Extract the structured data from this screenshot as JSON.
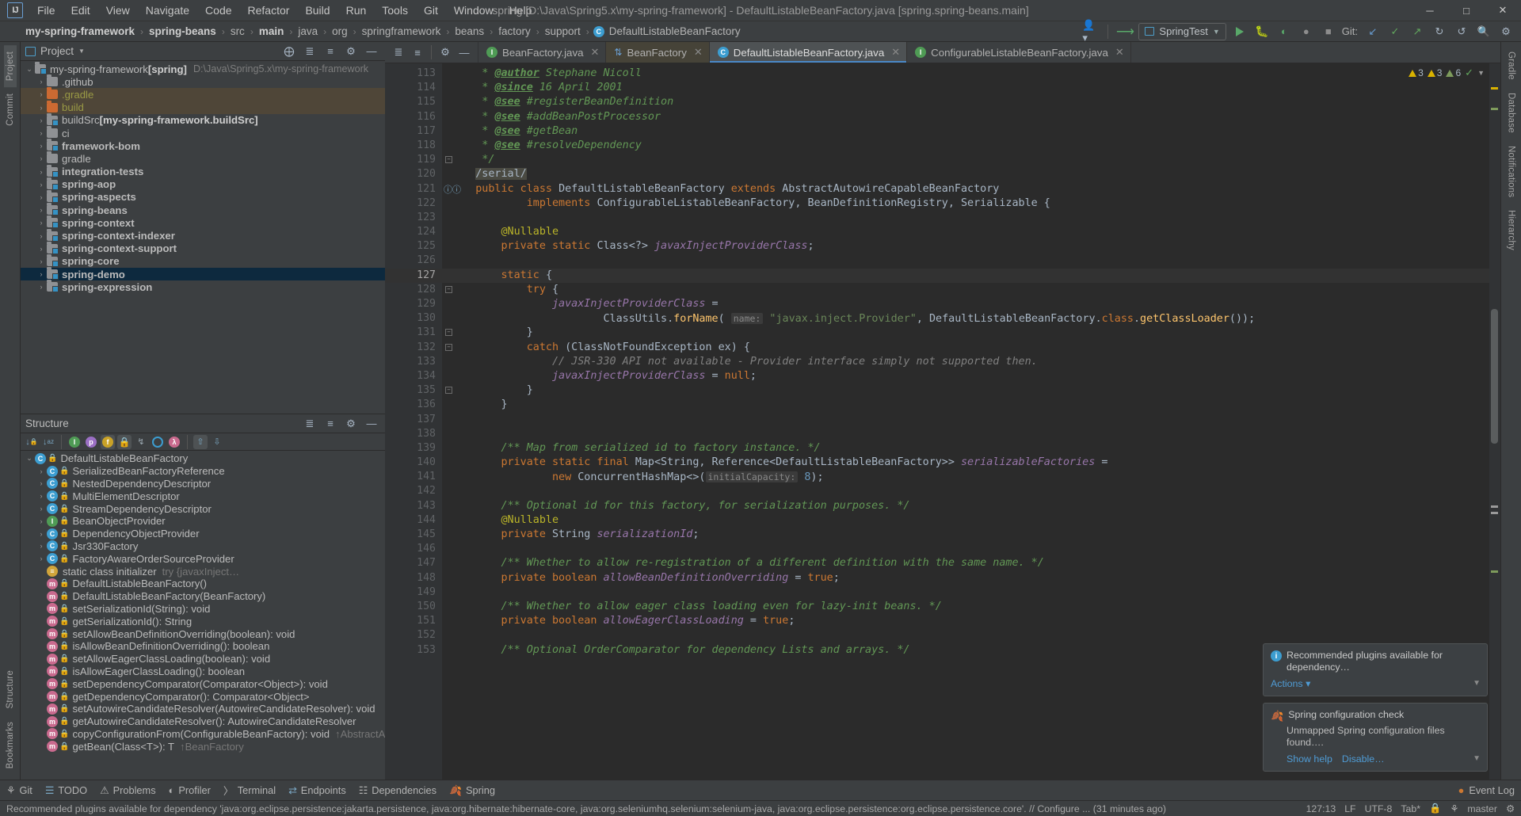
{
  "titlebar": {
    "logo": "IJ",
    "menus": [
      "File",
      "Edit",
      "View",
      "Navigate",
      "Code",
      "Refactor",
      "Build",
      "Run",
      "Tools",
      "Git",
      "Window",
      "Help"
    ],
    "window_title": "spring [D:\\Java\\Spring5.x\\my-spring-framework] - DefaultListableBeanFactory.java [spring.spring-beans.main]",
    "minimize": "─",
    "maximize": "□",
    "close": "✕"
  },
  "navbar": {
    "crumbs": [
      {
        "text": "my-spring-framework",
        "bold": true
      },
      {
        "text": "spring-beans",
        "bold": true
      },
      {
        "text": "src",
        "bold": false
      },
      {
        "text": "main",
        "bold": true
      },
      {
        "text": "java",
        "bold": false
      },
      {
        "text": "org",
        "bold": false
      },
      {
        "text": "springframework",
        "bold": false
      },
      {
        "text": "beans",
        "bold": false
      },
      {
        "text": "factory",
        "bold": false
      },
      {
        "text": "support",
        "bold": false
      },
      {
        "text": "DefaultListableBeanFactory",
        "bold": false,
        "icon": "C"
      }
    ],
    "separator": "›",
    "run_config": "SpringTest",
    "git_label": "Git:",
    "icons": [
      "account-icon",
      "updates-icon",
      "run-icon",
      "debug-icon",
      "coverage-icon",
      "profiler-icon",
      "stop-icon",
      "git-update-icon",
      "commit-icon",
      "push-icon",
      "history-icon",
      "rollback-icon",
      "search-icon",
      "settings-icon"
    ]
  },
  "left_strip": {
    "top": [
      "Project",
      "Commit"
    ],
    "bottom": [
      "Structure",
      "Bookmarks"
    ]
  },
  "right_strip": {
    "items": [
      "Gradle",
      "Database",
      "Notifications",
      "Hierarchy"
    ]
  },
  "project_panel": {
    "title": "Project",
    "tree": [
      {
        "depth": 0,
        "arrow": "⌄",
        "label": "my-spring-framework",
        "bracket": "[spring]",
        "path": "D:\\Java\\Spring5.x\\my-spring-framework",
        "bold": false,
        "folder": "module"
      },
      {
        "depth": 1,
        "arrow": "›",
        "label": ".github",
        "folder": "plain"
      },
      {
        "depth": 1,
        "arrow": "›",
        "label": ".gradle",
        "folder": "orange",
        "hl": true,
        "green": true
      },
      {
        "depth": 1,
        "arrow": "›",
        "label": "build",
        "folder": "orange",
        "hl": true,
        "green": true
      },
      {
        "depth": 1,
        "arrow": "›",
        "label": "buildSrc",
        "bracket": "[my-spring-framework.buildSrc]",
        "folder": "module"
      },
      {
        "depth": 1,
        "arrow": "›",
        "label": "ci",
        "folder": "plain"
      },
      {
        "depth": 1,
        "arrow": "›",
        "label": "framework-bom",
        "bold": true,
        "folder": "module"
      },
      {
        "depth": 1,
        "arrow": "›",
        "label": "gradle",
        "folder": "plain"
      },
      {
        "depth": 1,
        "arrow": "›",
        "label": "integration-tests",
        "bold": true,
        "folder": "module"
      },
      {
        "depth": 1,
        "arrow": "›",
        "label": "spring-aop",
        "bold": true,
        "folder": "module"
      },
      {
        "depth": 1,
        "arrow": "›",
        "label": "spring-aspects",
        "bold": true,
        "folder": "module"
      },
      {
        "depth": 1,
        "arrow": "›",
        "label": "spring-beans",
        "bold": true,
        "folder": "module"
      },
      {
        "depth": 1,
        "arrow": "›",
        "label": "spring-context",
        "bold": true,
        "folder": "module"
      },
      {
        "depth": 1,
        "arrow": "›",
        "label": "spring-context-indexer",
        "bold": true,
        "folder": "module"
      },
      {
        "depth": 1,
        "arrow": "›",
        "label": "spring-context-support",
        "bold": true,
        "folder": "module"
      },
      {
        "depth": 1,
        "arrow": "›",
        "label": "spring-core",
        "bold": true,
        "folder": "module"
      },
      {
        "depth": 1,
        "arrow": "›",
        "label": "spring-demo",
        "bold": true,
        "folder": "module",
        "sel": true
      },
      {
        "depth": 1,
        "arrow": "›",
        "label": "spring-expression",
        "bold": true,
        "folder": "module"
      }
    ]
  },
  "structure_panel": {
    "title": "Structure",
    "toolbar_icons": [
      "sort-by-visibility-icon",
      "sort-alphabetically-icon",
      "show-inherited-icon",
      "show-properties-icon",
      "show-fields-icon",
      "show-non-public-icon",
      "show-anonymous-icon",
      "show-interfaces-icon",
      "show-lambdas-icon",
      "expand-all-icon",
      "collapse-all-icon"
    ],
    "items": [
      {
        "arrow": "⌄",
        "icon": "C",
        "color": "c-blue",
        "lock": "green",
        "label": "DefaultListableBeanFactory",
        "depth": 0
      },
      {
        "arrow": "›",
        "icon": "C",
        "color": "c-blue",
        "lock": "orange",
        "label": "SerializedBeanFactoryReference",
        "depth": 1
      },
      {
        "arrow": "›",
        "icon": "C",
        "color": "c-blue",
        "lock": "orange",
        "label": "NestedDependencyDescriptor",
        "depth": 1
      },
      {
        "arrow": "›",
        "icon": "C",
        "color": "c-blue",
        "lock": "orange",
        "label": "MultiElementDescriptor",
        "depth": 1
      },
      {
        "arrow": "›",
        "icon": "C",
        "color": "c-blue",
        "lock": "orange",
        "label": "StreamDependencyDescriptor",
        "depth": 1
      },
      {
        "arrow": "›",
        "icon": "I",
        "color": "c-green",
        "lock": "orange",
        "label": "BeanObjectProvider",
        "depth": 1
      },
      {
        "arrow": "›",
        "icon": "C",
        "color": "c-blue",
        "lock": "orange",
        "label": "DependencyObjectProvider",
        "depth": 1
      },
      {
        "arrow": "›",
        "icon": "C",
        "color": "c-blue",
        "lock": "orange",
        "label": "Jsr330Factory",
        "depth": 1
      },
      {
        "arrow": "›",
        "icon": "C",
        "color": "c-blue",
        "lock": "orange",
        "label": "FactoryAwareOrderSourceProvider",
        "depth": 1
      },
      {
        "arrow": "",
        "icon": "≡",
        "color": "c-gray",
        "lock": "none",
        "label": "static class initializer",
        "dim": "try {javaxInject…",
        "depth": 1
      },
      {
        "arrow": "",
        "icon": "m",
        "color": "c-pink",
        "lock": "green",
        "label": "DefaultListableBeanFactory()",
        "depth": 1
      },
      {
        "arrow": "",
        "icon": "m",
        "color": "c-pink",
        "lock": "green",
        "label": "DefaultListableBeanFactory(BeanFactory)",
        "depth": 1
      },
      {
        "arrow": "",
        "icon": "m",
        "color": "c-pink",
        "lock": "green",
        "label": "setSerializationId(String): void",
        "depth": 1
      },
      {
        "arrow": "",
        "icon": "m",
        "color": "c-pink",
        "lock": "green",
        "label": "getSerializationId(): String",
        "depth": 1
      },
      {
        "arrow": "",
        "icon": "m",
        "color": "c-pink",
        "lock": "green",
        "label": "setAllowBeanDefinitionOverriding(boolean): void",
        "depth": 1
      },
      {
        "arrow": "",
        "icon": "m",
        "color": "c-pink",
        "lock": "green",
        "label": "isAllowBeanDefinitionOverriding(): boolean",
        "depth": 1
      },
      {
        "arrow": "",
        "icon": "m",
        "color": "c-pink",
        "lock": "green",
        "label": "setAllowEagerClassLoading(boolean): void",
        "depth": 1
      },
      {
        "arrow": "",
        "icon": "m",
        "color": "c-pink",
        "lock": "green",
        "label": "isAllowEagerClassLoading(): boolean",
        "depth": 1
      },
      {
        "arrow": "",
        "icon": "m",
        "color": "c-pink",
        "lock": "green",
        "label": "setDependencyComparator(Comparator<Object>): void",
        "depth": 1
      },
      {
        "arrow": "",
        "icon": "m",
        "color": "c-pink",
        "lock": "green",
        "label": "getDependencyComparator(): Comparator<Object>",
        "depth": 1
      },
      {
        "arrow": "",
        "icon": "m",
        "color": "c-pink",
        "lock": "green",
        "label": "setAutowireCandidateResolver(AutowireCandidateResolver): void",
        "depth": 1
      },
      {
        "arrow": "",
        "icon": "m",
        "color": "c-pink",
        "lock": "green",
        "label": "getAutowireCandidateResolver(): AutowireCandidateResolver",
        "depth": 1
      },
      {
        "arrow": "",
        "icon": "m",
        "color": "c-pink",
        "lock": "green",
        "label": "copyConfigurationFrom(ConfigurableBeanFactory): void",
        "dim": "↑AbstractAutowireCapable…",
        "depth": 1
      },
      {
        "arrow": "",
        "icon": "m",
        "color": "c-pink",
        "lock": "green",
        "label": "getBean(Class<T>): T",
        "dim": "↑BeanFactory",
        "depth": 1
      }
    ]
  },
  "editor": {
    "tabs": [
      {
        "label": "BeanFactory.java",
        "icon": "I",
        "color": "c-green",
        "state": "normal"
      },
      {
        "label": "BeanFactory",
        "icon": "↑↓",
        "color": "blue-arrows",
        "state": "modified"
      },
      {
        "label": "DefaultListableBeanFactory.java",
        "icon": "C",
        "color": "c-blue",
        "state": "active"
      },
      {
        "label": "ConfigurableListableBeanFactory.java",
        "icon": "I",
        "color": "c-green",
        "state": "normal"
      }
    ],
    "inspection": {
      "warnings": "3",
      "weak_warnings": "3",
      "typos": "6",
      "ok": "✓"
    },
    "first_line": 113,
    "current_line": 127,
    "lines": [
      {
        "n": 113,
        "html": "    <span class=\"doc\"> * </span><span class=\"doctag\">@author</span><span class=\"doc\"> Stephane Nicoll</span>"
      },
      {
        "n": 114,
        "html": "    <span class=\"doc\"> * </span><span class=\"doctag\">@since</span><span class=\"doc\"> 16 April 2001</span>"
      },
      {
        "n": 115,
        "html": "    <span class=\"doc\"> * </span><span class=\"doctag\">@see</span><span class=\"doc\"> #registerBeanDefinition</span>"
      },
      {
        "n": 116,
        "html": "    <span class=\"doc\"> * </span><span class=\"doctag\">@see</span><span class=\"doc\"> #addBeanPostProcessor</span>"
      },
      {
        "n": 117,
        "html": "    <span class=\"doc\"> * </span><span class=\"doctag\">@see</span><span class=\"doc\"> #getBean</span>"
      },
      {
        "n": 118,
        "html": "    <span class=\"doc\"> * </span><span class=\"doctag\">@see</span><span class=\"doc\"> #resolveDependency</span>"
      },
      {
        "n": 119,
        "html": "    <span class=\"doc\"> */</span>",
        "fold": true
      },
      {
        "n": 120,
        "html": "    <span class=\"serial-hl\">/serial/</span>"
      },
      {
        "n": 121,
        "html": "    <span class=\"kw\">public class </span><span class=\"cls\">DefaultListableBeanFactory </span><span class=\"kw\">extends </span><span class=\"cls\">AbstractAutowireCapableBeanFactory</span>",
        "marks": true
      },
      {
        "n": 122,
        "html": "            <span class=\"kw\">implements </span><span class=\"cls\">ConfigurableListableBeanFactory, BeanDefinitionRegistry, Serializable {</span>"
      },
      {
        "n": 123,
        "html": ""
      },
      {
        "n": 124,
        "html": "        <span class=\"ann\">@Nullable</span>"
      },
      {
        "n": 125,
        "html": "        <span class=\"kw\">private static </span><span class=\"cls\">Class&lt;?&gt; </span><span class=\"fld\">javaxInjectProviderClass</span><span class=\"cls\">;</span>"
      },
      {
        "n": 126,
        "html": ""
      },
      {
        "n": 127,
        "html": "        <span class=\"kw\">static </span><span class=\"cls\">{</span>",
        "cur": true,
        "fold": true
      },
      {
        "n": 128,
        "html": "            <span class=\"kw\">try </span><span class=\"cls\">{</span>",
        "fold": true
      },
      {
        "n": 129,
        "html": "                <span class=\"fld\">javaxInjectProviderClass</span><span class=\"cls\"> =</span>"
      },
      {
        "n": 130,
        "html": "                        <span class=\"cls\">ClassUtils.</span><span class=\"mth\">forName</span><span class=\"cls\">( </span><span class=\"hint\">name:</span><span class=\"str\"> \"javax.inject.Provider\"</span><span class=\"cls\">, DefaultListableBeanFactory.</span><span class=\"kw\">class</span><span class=\"cls\">.</span><span class=\"mth\">getClassLoader</span><span class=\"cls\">());</span>"
      },
      {
        "n": 131,
        "html": "            <span class=\"cls\">}</span>",
        "fold": true
      },
      {
        "n": 132,
        "html": "            <span class=\"kw\">catch </span><span class=\"cls\">(ClassNotFoundException ex) {</span>",
        "fold": true
      },
      {
        "n": 133,
        "html": "                <span class=\"cmt2\">// JSR-330 API not available - Provider interface simply not supported then.</span>"
      },
      {
        "n": 134,
        "html": "                <span class=\"fld\">javaxInjectProviderClass</span><span class=\"cls\"> = </span><span class=\"kw\">null</span><span class=\"cls\">;</span>"
      },
      {
        "n": 135,
        "html": "            <span class=\"cls\">}</span>",
        "fold": true
      },
      {
        "n": 136,
        "html": "        <span class=\"cls\">}</span>"
      },
      {
        "n": 137,
        "html": ""
      },
      {
        "n": 138,
        "html": ""
      },
      {
        "n": 139,
        "html": "        <span class=\"cmt\">/** Map from serialized id to factory instance. */</span>"
      },
      {
        "n": 140,
        "html": "        <span class=\"kw\">private static final </span><span class=\"cls\">Map&lt;String, Reference&lt;DefaultListableBeanFactory&gt;&gt; </span><span class=\"fld\">serializableFactories</span><span class=\"cls\"> =</span>"
      },
      {
        "n": 141,
        "html": "                <span class=\"kw\">new </span><span class=\"cls\">ConcurrentHashMap&lt;&gt;(</span><span class=\"hint\">initialCapacity:</span><span class=\"num\"> 8</span><span class=\"cls\">);</span>"
      },
      {
        "n": 142,
        "html": ""
      },
      {
        "n": 143,
        "html": "        <span class=\"cmt\">/** Optional id for this factory, for serialization purposes. */</span>"
      },
      {
        "n": 144,
        "html": "        <span class=\"ann\">@Nullable</span>"
      },
      {
        "n": 145,
        "html": "        <span class=\"kw\">private </span><span class=\"cls\">String </span><span class=\"fld\">serializationId</span><span class=\"cls\">;</span>"
      },
      {
        "n": 146,
        "html": ""
      },
      {
        "n": 147,
        "html": "        <span class=\"cmt\">/** Whether to allow re-registration of a different definition with the same name. */</span>"
      },
      {
        "n": 148,
        "html": "        <span class=\"kw\">private boolean </span><span class=\"fld\">allowBeanDefinitionOverriding</span><span class=\"cls\"> = </span><span class=\"kw\">true</span><span class=\"cls\">;</span>"
      },
      {
        "n": 149,
        "html": ""
      },
      {
        "n": 150,
        "html": "        <span class=\"cmt\">/** Whether to allow eager class loading even for lazy-init beans. */</span>"
      },
      {
        "n": 151,
        "html": "        <span class=\"kw\">private boolean </span><span class=\"fld\">allowEagerClassLoading</span><span class=\"cls\"> = </span><span class=\"kw\">true</span><span class=\"cls\">;</span>"
      },
      {
        "n": 152,
        "html": ""
      },
      {
        "n": 153,
        "html": "        <span class=\"cmt\">/** Optional OrderComparator for dependency Lists and arrays. */</span>"
      }
    ]
  },
  "notifications": [
    {
      "icon": "info",
      "title": "Recommended plugins available for dependency…",
      "link": "Actions ▾",
      "links": []
    },
    {
      "icon": "spring",
      "title": "Spring configuration check",
      "body": "Unmapped Spring configuration files found….",
      "links": [
        "Show help",
        "Disable…"
      ]
    }
  ],
  "bottom_bar": {
    "items": [
      {
        "label": "Git",
        "icon": "git-icon"
      },
      {
        "label": "TODO",
        "icon": "todo-icon"
      },
      {
        "label": "Problems",
        "icon": "problems-icon"
      },
      {
        "label": "Profiler",
        "icon": "profiler-icon"
      },
      {
        "label": "Terminal",
        "icon": "terminal-icon"
      },
      {
        "label": "Endpoints",
        "icon": "endpoints-icon"
      },
      {
        "label": "Dependencies",
        "icon": "dependencies-icon"
      },
      {
        "label": "Spring",
        "icon": "spring-icon"
      }
    ],
    "right": {
      "label": "Event Log",
      "icon": "event-log-icon"
    }
  },
  "status_bar": {
    "message": "Recommended plugins available for dependency 'java:org.eclipse.persistence:jakarta.persistence, java:org.hibernate:hibernate-core, java:org.seleniumhq.selenium:selenium-java, java:org.eclipse.persistence:org.eclipse.persistence.core'. // Configure ... (31 minutes ago)",
    "caret": "127:13",
    "line_sep": "LF",
    "encoding": "UTF-8",
    "indent": "Tab*",
    "branch": "master",
    "lock_icon": "read-only-icon",
    "inspection_icon": "inspection-icon"
  }
}
